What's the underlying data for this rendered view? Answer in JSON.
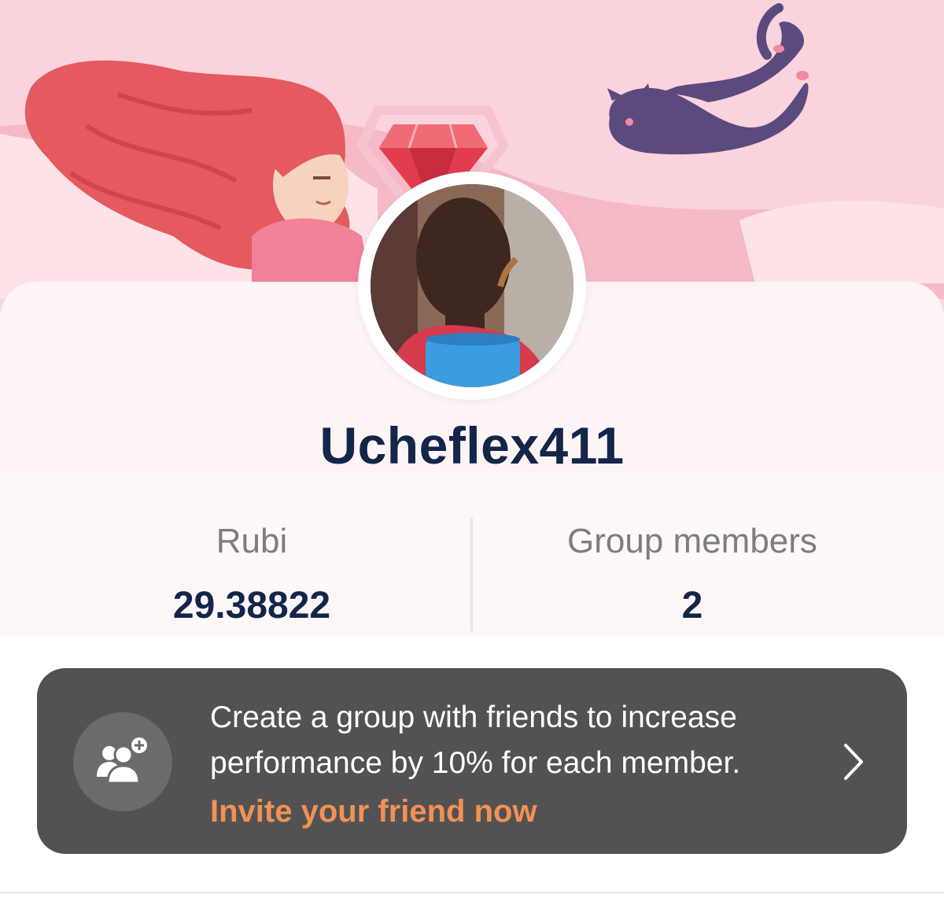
{
  "profile": {
    "username": "Ucheflex411"
  },
  "stats": {
    "left": {
      "label": "Rubi",
      "value": "29.38822"
    },
    "right": {
      "label": "Group members",
      "value": "2"
    }
  },
  "invite": {
    "description": "Create a group with friends to increase performance by 10% for each member.",
    "cta": "Invite your friend now",
    "icon": "add-group-icon"
  },
  "colors": {
    "header_bg": "#fbd3dc",
    "username": "#14254a",
    "stat_label": "#7d7d7d",
    "banner_bg": "#525252",
    "cta": "#f29155"
  }
}
